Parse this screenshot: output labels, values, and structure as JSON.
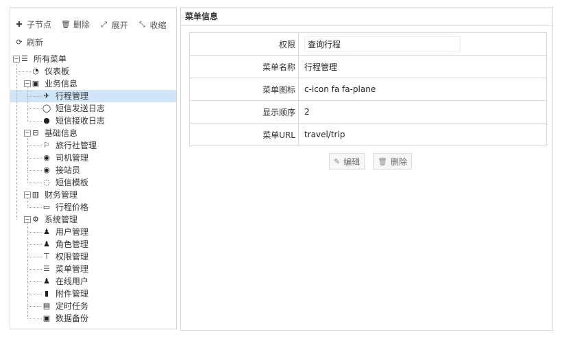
{
  "toolbar": {
    "add_child": "子节点",
    "delete": "删除",
    "expand": "展开",
    "collapse": "收缩",
    "refresh": "刷新"
  },
  "tree": [
    {
      "label": "所有菜单",
      "icon": "list-icon",
      "glyph": "☰",
      "level": 0,
      "toggle": "−"
    },
    {
      "label": "仪表板",
      "icon": "dashboard-icon",
      "glyph": "◔",
      "level": 1
    },
    {
      "label": "业务信息",
      "icon": "bus-icon",
      "glyph": "▣",
      "level": 1,
      "toggle": "−"
    },
    {
      "label": "行程管理",
      "icon": "plane-icon",
      "glyph": "✈",
      "level": 2,
      "selected": true
    },
    {
      "label": "短信发送日志",
      "icon": "comment-outline-icon",
      "glyph": "◯",
      "level": 2
    },
    {
      "label": "短信接收日志",
      "icon": "comment-icon",
      "glyph": "●",
      "level": 2
    },
    {
      "label": "基础信息",
      "icon": "hdd-icon",
      "glyph": "⊟",
      "level": 1,
      "toggle": "−"
    },
    {
      "label": "旅行社管理",
      "icon": "flag-icon",
      "glyph": "⚐",
      "level": 2
    },
    {
      "label": "司机管理",
      "icon": "user-circle-icon",
      "glyph": "◉",
      "level": 2
    },
    {
      "label": "接站员",
      "icon": "user-circle-icon",
      "glyph": "◉",
      "level": 2
    },
    {
      "label": "短信模板",
      "icon": "comments-icon",
      "glyph": "◌",
      "level": 2
    },
    {
      "label": "财务管理",
      "icon": "bar-chart-icon",
      "glyph": "▥",
      "level": 1,
      "toggle": "−"
    },
    {
      "label": "行程价格",
      "icon": "money-icon",
      "glyph": "▭",
      "level": 2
    },
    {
      "label": "系统管理",
      "icon": "cogs-icon",
      "glyph": "⚙",
      "level": 1,
      "toggle": "−"
    },
    {
      "label": "用户管理",
      "icon": "user-icon",
      "glyph": "♟",
      "level": 2
    },
    {
      "label": "角色管理",
      "icon": "users-icon",
      "glyph": "♟",
      "level": 2
    },
    {
      "label": "权限管理",
      "icon": "sitemap-icon",
      "glyph": "⊤",
      "level": 2
    },
    {
      "label": "菜单管理",
      "icon": "bars-icon",
      "glyph": "☰",
      "level": 2
    },
    {
      "label": "在线用户",
      "icon": "user-icon",
      "glyph": "♟",
      "level": 2
    },
    {
      "label": "附件管理",
      "icon": "file-icon",
      "glyph": "▮",
      "level": 2
    },
    {
      "label": "定时任务",
      "icon": "server-icon",
      "glyph": "▤",
      "level": 2
    },
    {
      "label": "数据备份",
      "icon": "save-icon",
      "glyph": "▣",
      "level": 2
    }
  ],
  "panel": {
    "title": "菜单信息",
    "rows": [
      {
        "label": "权限",
        "value": "查询行程",
        "editable": true
      },
      {
        "label": "菜单名称",
        "value": "行程管理"
      },
      {
        "label": "菜单图标",
        "value": "c-icon fa fa-plane"
      },
      {
        "label": "显示顺序",
        "value": "2"
      },
      {
        "label": "菜单URL",
        "value": "travel/trip"
      }
    ],
    "edit_button": "编辑",
    "delete_button": "删除"
  }
}
